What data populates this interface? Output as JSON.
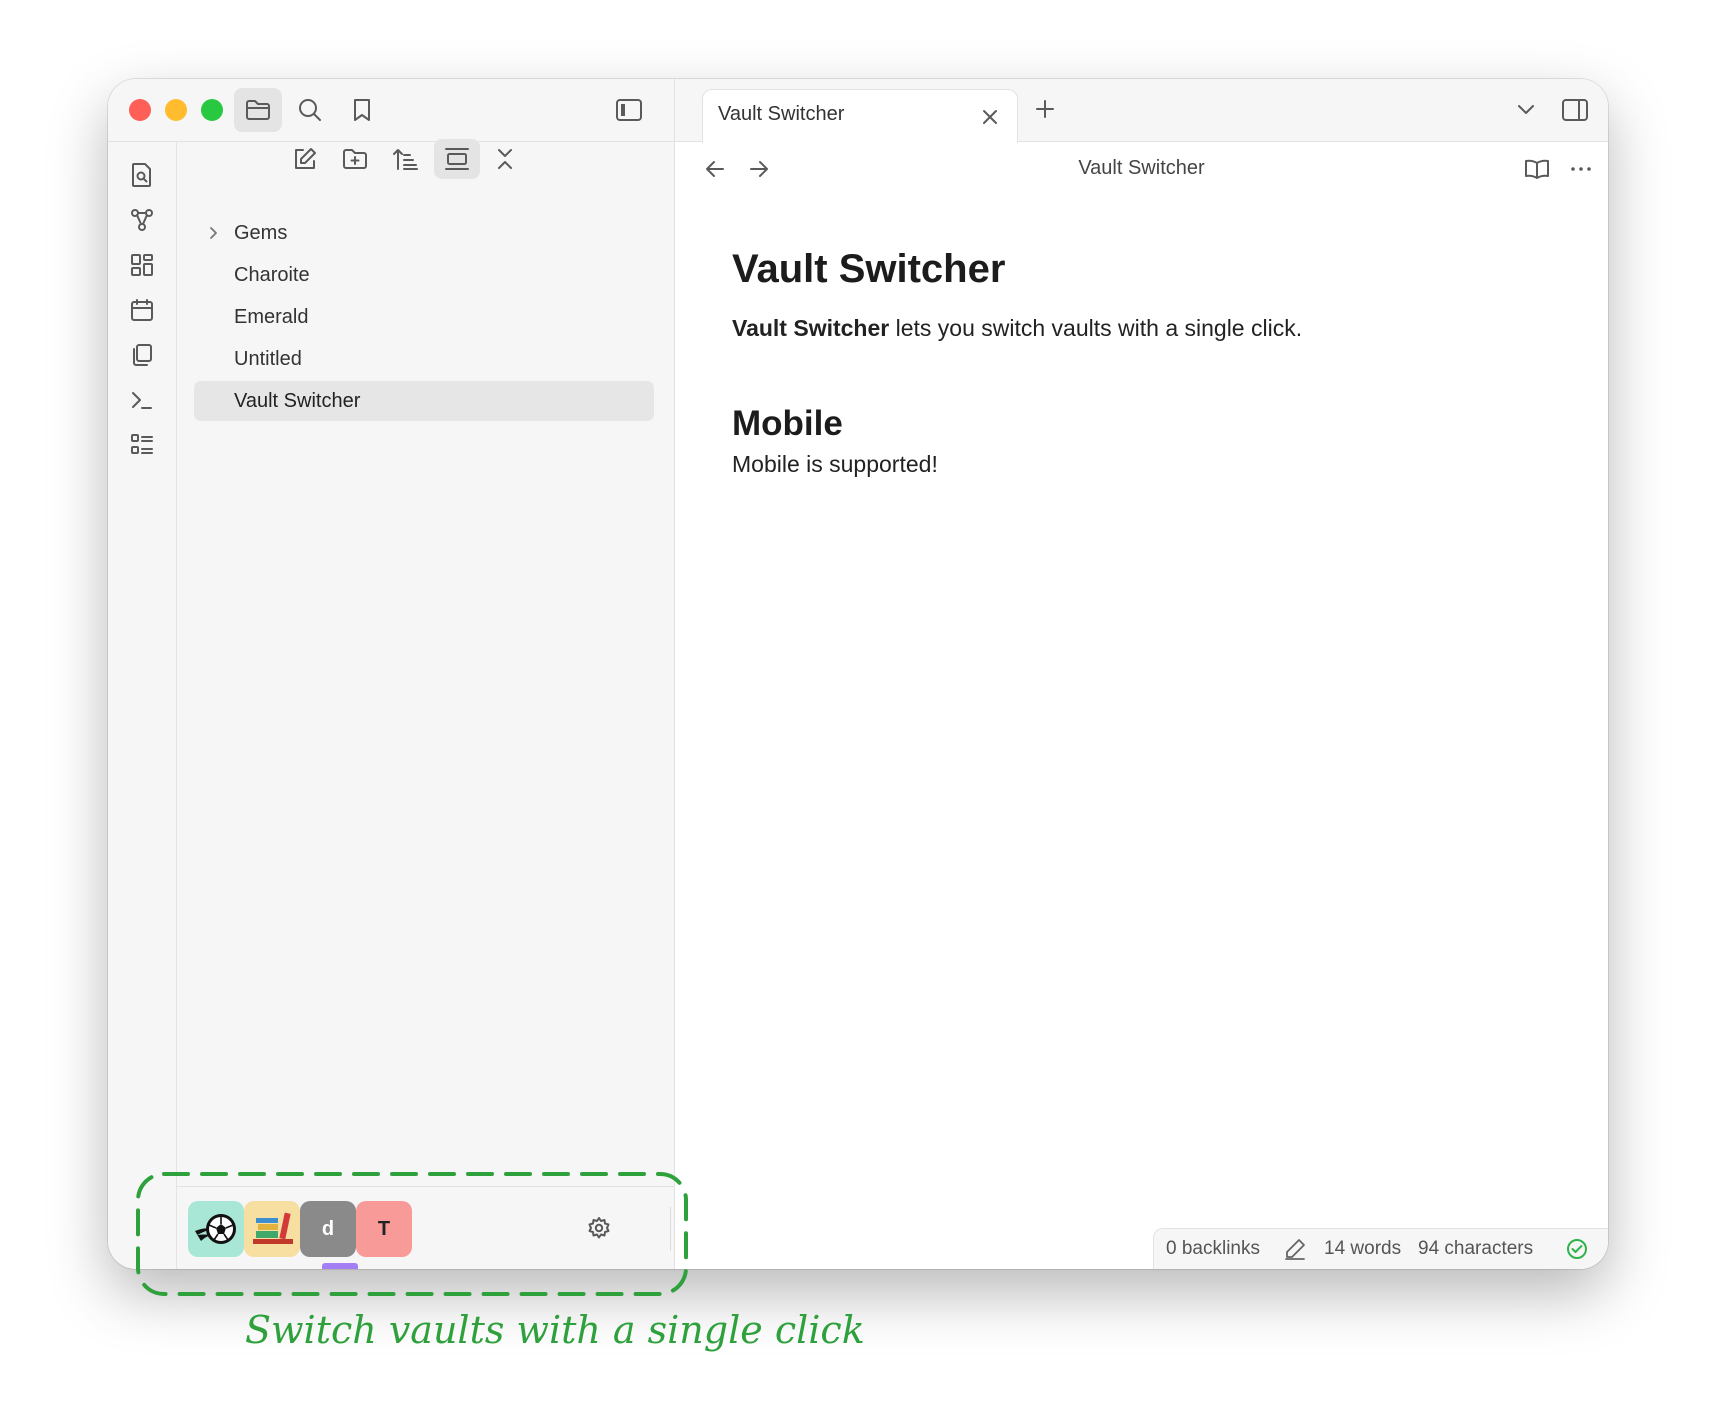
{
  "file_explorer": {
    "items": [
      {
        "label": "Gems",
        "type": "folder"
      },
      {
        "label": "Charoite",
        "type": "file"
      },
      {
        "label": "Emerald",
        "type": "file"
      },
      {
        "label": "Untitled",
        "type": "file"
      },
      {
        "label": "Vault Switcher",
        "type": "file",
        "selected": true
      }
    ]
  },
  "vault_switcher": {
    "vaults": [
      {
        "icon": "soccer-ball-icon",
        "color": "#a8e6d5"
      },
      {
        "icon": "books-icon",
        "color": "#f6dfa0"
      },
      {
        "letter": "d",
        "color": "#8a8a8a",
        "active": true
      },
      {
        "letter": "T",
        "color": "#f89a98"
      }
    ],
    "active_indicator_color": "#a37ef5"
  },
  "tab": {
    "title": "Vault Switcher"
  },
  "view_header": {
    "title": "Vault Switcher"
  },
  "note": {
    "h1": "Vault Switcher",
    "para_bold": "Vault Switcher",
    "para_rest": " lets you switch vaults with a single click.",
    "h2": "Mobile",
    "para2": "Mobile is supported!"
  },
  "status_bar": {
    "backlinks": "0 backlinks",
    "words": "14 words",
    "characters": "94 characters"
  },
  "annotation": {
    "text": "Switch vaults with a single click",
    "color": "#2ea03c"
  },
  "colors": {
    "traffic_red": "#fe5f57",
    "traffic_yellow": "#febc2e",
    "traffic_green": "#28c840",
    "sidebar_bg": "#f6f6f6",
    "selected_bg": "#e6e6e6"
  }
}
